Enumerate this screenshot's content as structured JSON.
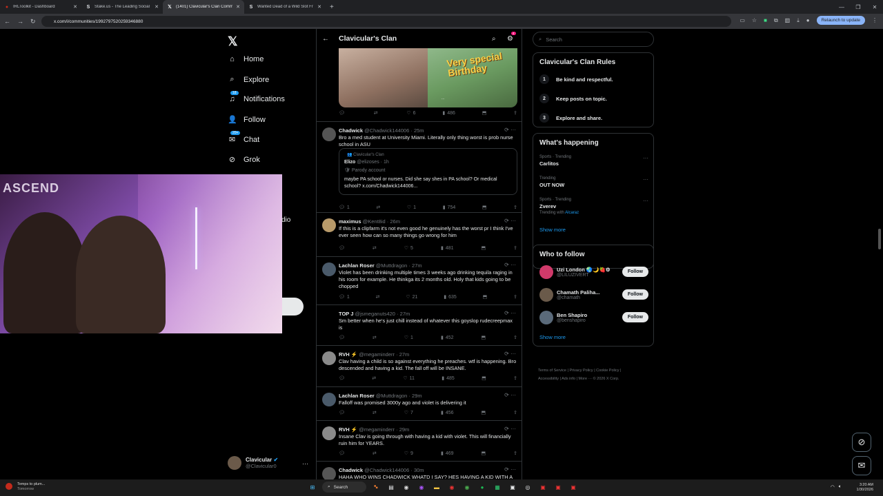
{
  "browser": {
    "tabs": [
      {
        "label": "IRLToolkit - Dashboard",
        "icon": "irltoolkit-icon"
      },
      {
        "label": "Stake.us - The Leading Social C",
        "icon": "stake-icon"
      },
      {
        "label": "(1401) Clavicular's Clan Commu",
        "icon": "x-logo-icon",
        "active": true
      },
      {
        "label": "Wanted Dead of a Wild Slot Fr",
        "icon": "stake-icon"
      }
    ],
    "url": "x.com/i/communities/1992797520259346880",
    "relaunch_label": "Relaunch to update"
  },
  "left_nav": {
    "items": [
      {
        "label": "Home",
        "icon": "home-icon"
      },
      {
        "label": "Explore",
        "icon": "search-icon"
      },
      {
        "label": "Notifications",
        "icon": "bell-icon",
        "badge": "18"
      },
      {
        "label": "Follow",
        "icon": "follow-icon"
      },
      {
        "label": "Chat",
        "icon": "chat-icon",
        "badge": "20+"
      },
      {
        "label": "Grok",
        "icon": "grok-icon"
      }
    ],
    "partial_label": "dio",
    "profile": {
      "name": "Clavicular",
      "handle": "@Clavicular0"
    }
  },
  "column": {
    "title": "Clavicular's Clan",
    "settings_badge": "4",
    "media_text": "Very special Birthday",
    "media_caption": "...",
    "top_actions": {
      "replies": "",
      "reposts": "",
      "likes": "6",
      "views": "486"
    },
    "tweets": [
      {
        "name": "Chadwick",
        "handle": "@Chadwick144006",
        "time": "25m",
        "text": "Bro a med student at University Miami. Literally only thing worst is prob nurse school in ASU",
        "replies": "1",
        "reposts": "",
        "likes": "1",
        "views": "754",
        "quote": {
          "community": "Clavicular's Clan",
          "name": "Elizo",
          "handle": "@elizoses",
          "time": "1h",
          "parody": "Parody account",
          "text": "maybe PA school or nurses. Did she say shes in PA school? Or medical school? x.com/Chadwick144006..."
        }
      },
      {
        "name": "maximus",
        "handle": "@Kent8id",
        "time": "26m",
        "text": "If this is a clipfarm it's not even good he genuinely has the worst pr I think I've ever seen how can so many things go wrong for him",
        "replies": "",
        "reposts": "",
        "likes": "5",
        "views": "481"
      },
      {
        "name": "Lachlan Roser",
        "handle": "@Muttdragon",
        "time": "27m",
        "text": "Violet has been drinking multiple times 3 weeks ago drinking tequila raging in his room for example. He thinkga its 2 months old. Holy that kids going to be chopped",
        "replies": "1",
        "reposts": "",
        "likes": "21",
        "views": "635"
      },
      {
        "name": "TOP J",
        "handle": "@jsmeganuts420",
        "time": "27m",
        "text": "Sm better when he's just chill instead of whatever this goyslop rudecreepmax is",
        "replies": "",
        "reposts": "",
        "likes": "1",
        "views": "452"
      },
      {
        "name": "RVH ⚡",
        "handle": "@megaminderr",
        "time": "27m",
        "text": "Clav having a child is so against everything he preaches. wtf is happening. Bro descended and having a kid. The fall off will be INSANE.",
        "replies": "",
        "reposts": "",
        "likes": "11",
        "views": "485"
      },
      {
        "name": "Lachlan Roser",
        "handle": "@Muttdragon",
        "time": "29m",
        "text": "Falloff was promised 3000y ago and violet is delivering it",
        "replies": "",
        "reposts": "",
        "likes": "7",
        "views": "456"
      },
      {
        "name": "RVH ⚡",
        "handle": "@megaminderr",
        "time": "29m",
        "text": "Insane Clav is going through with having a kid with violet. This will financially ruin him for YEARS.",
        "replies": "",
        "reposts": "",
        "likes": "9",
        "views": "469"
      },
      {
        "name": "Chadwick",
        "handle": "@Chadwick144006",
        "time": "30m",
        "text": "HAHA WHO WINS CHADWICK WHATD I SAY? HES HAVING A KID WITH A",
        "replies": "",
        "reposts": "",
        "likes": "",
        "views": ""
      }
    ]
  },
  "right": {
    "search_placeholder": "Search",
    "rules_title": "Clavicular's Clan Rules",
    "rules": [
      "Be kind and respectful.",
      "Keep posts on topic.",
      "Explore and share."
    ],
    "happening_title": "What's happening",
    "trends": [
      {
        "context": "Sports · Trending",
        "name": "Carlitos",
        "with": ""
      },
      {
        "context": "Trending",
        "name": "OUT NOW",
        "with": ""
      },
      {
        "context": "Sports · Trending",
        "name": "Zverev",
        "with_prefix": "Trending with",
        "with": "Alcaraz"
      }
    ],
    "show_more": "Show more",
    "wtf_title": "Who to follow",
    "follow_suggestions": [
      {
        "name": "Uzi London 🌏🌙🍓⚙",
        "handle": "@LILUZIVERT",
        "button": "Follow"
      },
      {
        "name": "Chamath Paliha...",
        "handle": "@chamath",
        "button": "Follow"
      },
      {
        "name": "Ben Shapiro",
        "handle": "@benshapiro",
        "button": "Follow"
      }
    ],
    "footer_line1": "Terms of Service  |  Privacy Policy  |  Cookie Policy  |",
    "footer_line2": "Accessibility  |  Ads info  |  More ···  © 2026 X Corp."
  },
  "taskbar": {
    "weather_line1": "Temps to plum...",
    "weather_line2": "Tomorrow",
    "search_label": "Search",
    "time": "3:20 AM",
    "date": "1/30/2026"
  }
}
